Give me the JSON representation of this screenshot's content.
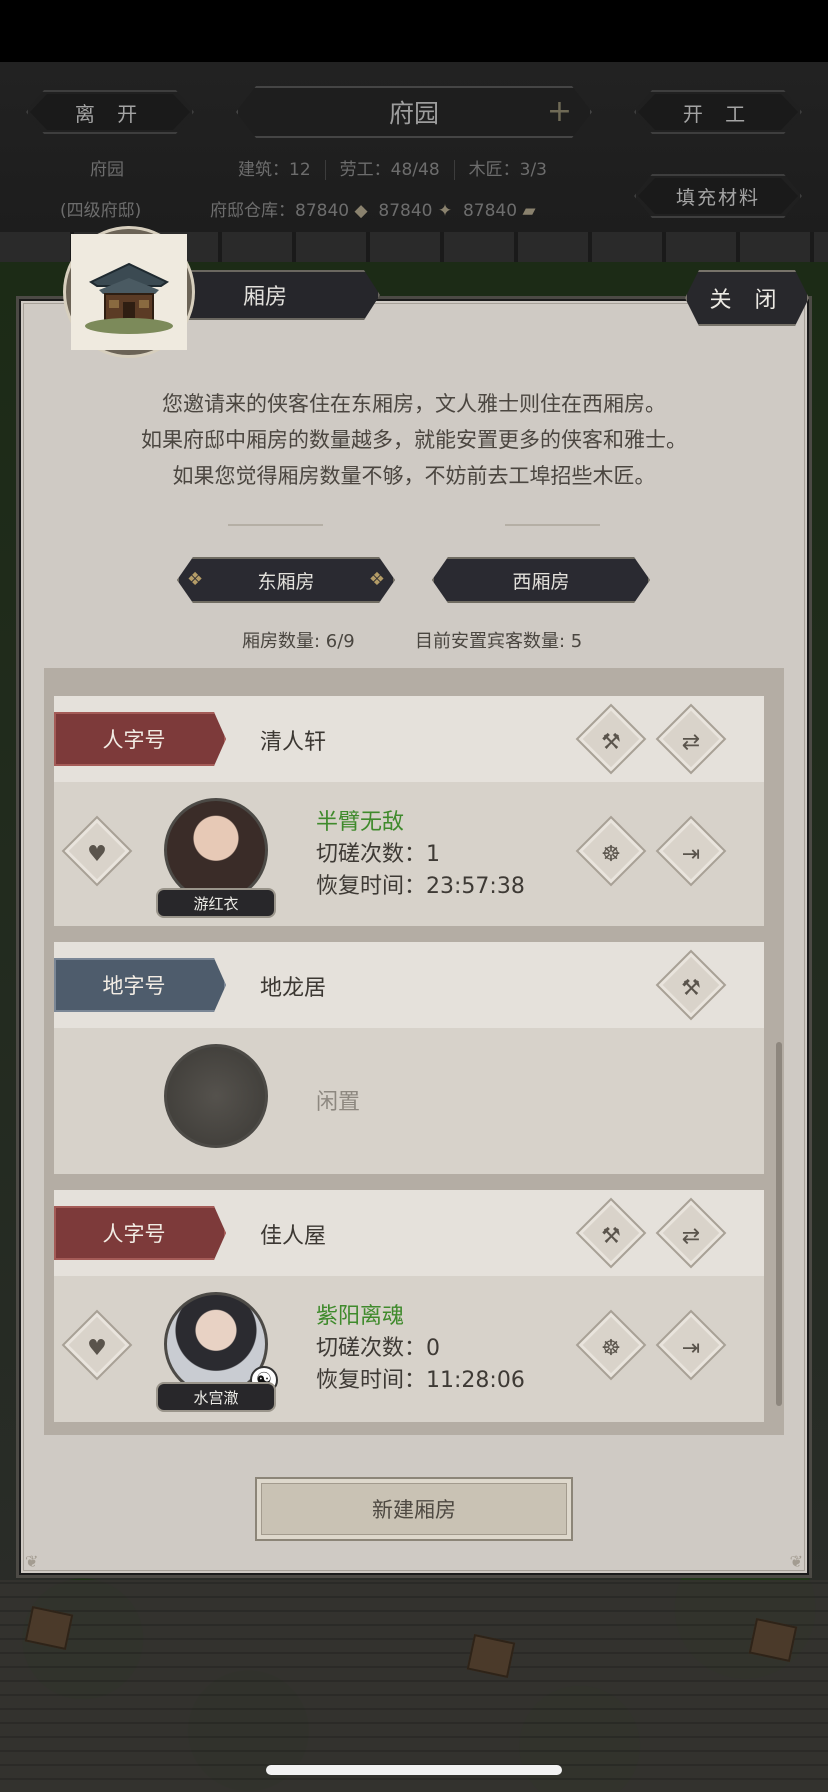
{
  "header": {
    "leave_label": "离 开",
    "title": "府园",
    "start_label": "开 工",
    "location_name": "府园",
    "location_level": "(四级府邸)",
    "buildings": "建筑：12",
    "labor": "劳工：48/48",
    "carpenter": "木匠：3/3",
    "warehouse_label": "府邸仓库：",
    "stock1": "87840",
    "stock2": "87840",
    "stock3": "87840",
    "fill_label": "填充材料"
  },
  "dialog": {
    "title": "厢房",
    "close_label": "关 闭",
    "desc_line1": "您邀请来的侠客住在东厢房，文人雅士则住在西厢房。",
    "desc_line2": "如果府邸中厢房的数量越多，就能安置更多的侠客和雅士。",
    "desc_line3": "如果您觉得厢房数量不够，不妨前去工埠招些木匠。",
    "tab_east": "东厢房",
    "tab_west": "西厢房",
    "room_count": "厢房数量: 6/9",
    "guest_count": "目前安置宾客数量: 5",
    "new_room_label": "新建厢房"
  },
  "rooms": [
    {
      "grade": "人字号",
      "name": "清人轩",
      "guest": "半臂无敌",
      "spar_label": "切磋次数：",
      "spar": "1",
      "recover_label": "恢复时间：",
      "recover": "23:57:38",
      "avatar_name": "游红衣"
    },
    {
      "grade": "地字号",
      "name": "地龙居",
      "status": "闲置"
    },
    {
      "grade": "人字号",
      "name": "佳人屋",
      "guest": "紫阳离魂",
      "spar_label": "切磋次数：",
      "spar": "0",
      "recover_label": "恢复时间：",
      "recover": "11:28:06",
      "avatar_name": "水宫澈"
    }
  ],
  "icons": {
    "upgrade": "hammer-icon",
    "swap": "swap-icon",
    "favor": "heart-icon",
    "train": "paw-icon",
    "leave": "exit-icon"
  },
  "colors": {
    "guest_name": "#3f8a2c",
    "badge_red": "#7d3a3a",
    "badge_blue": "#4e5c6c"
  }
}
